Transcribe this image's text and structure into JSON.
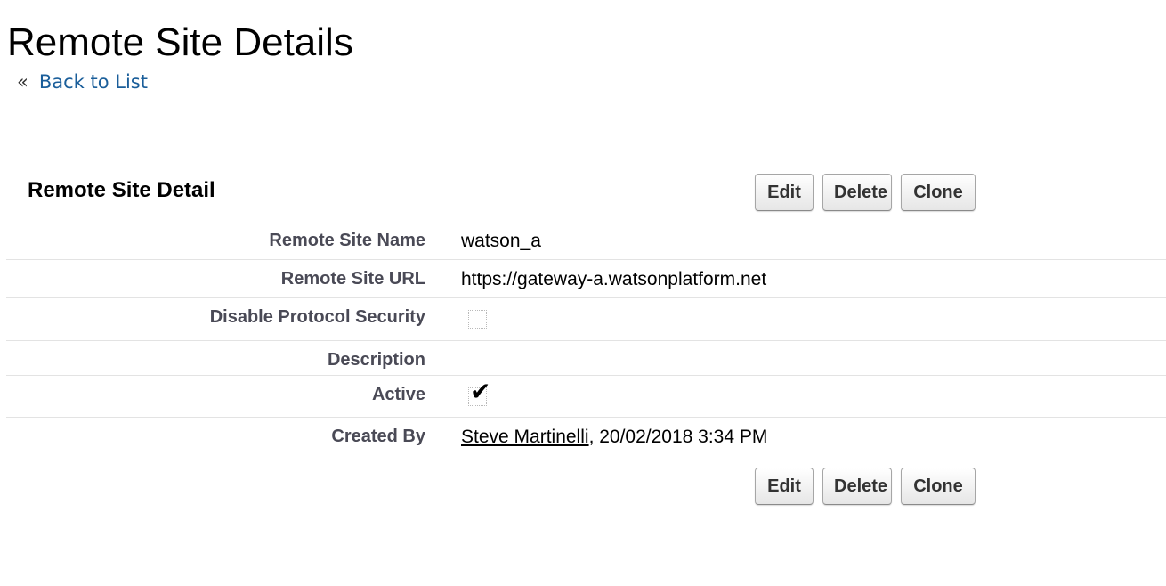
{
  "page": {
    "title": "Remote Site Details",
    "back_raquo": "«",
    "back_link": "Back to List"
  },
  "section": {
    "title": "Remote Site Detail"
  },
  "buttons": {
    "edit": "Edit",
    "delete": "Delete",
    "clone": "Clone"
  },
  "fields": {
    "remote_site_name": {
      "label": "Remote Site Name",
      "value": "watson_a"
    },
    "remote_site_url": {
      "label": "Remote Site URL",
      "value": "https://gateway-a.watsonplatform.net"
    },
    "disable_protocol_security": {
      "label": "Disable Protocol Security",
      "checked": false
    },
    "description": {
      "label": "Description",
      "value": ""
    },
    "active": {
      "label": "Active",
      "checked": true,
      "check_glyph": "✔"
    },
    "created_by": {
      "label": "Created By",
      "user": "Steve Martinelli",
      "date": ", 20/02/2018 3:34 PM"
    }
  }
}
